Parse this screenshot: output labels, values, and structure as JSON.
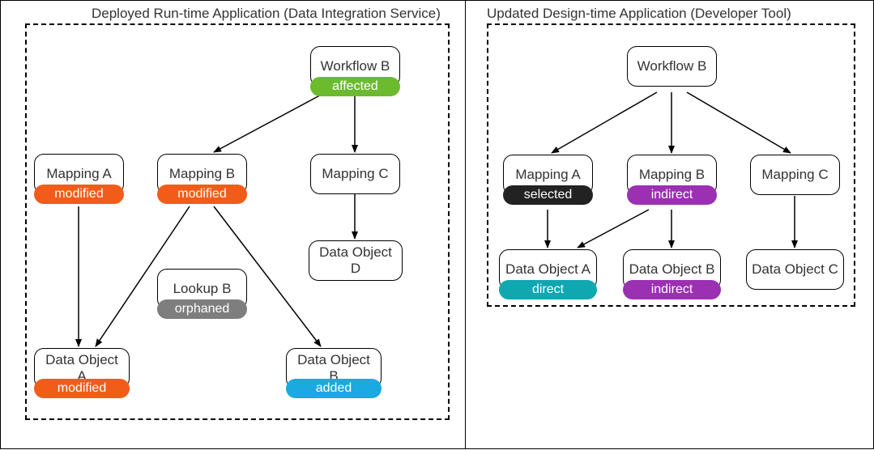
{
  "left_panel": {
    "title": "Deployed Run-time Application (Data Integration Service)",
    "nodes": {
      "workflow_b": {
        "label": "Workflow B",
        "badge": "affected"
      },
      "mapping_a": {
        "label": "Mapping A",
        "badge": "modified"
      },
      "mapping_b": {
        "label": "Mapping B",
        "badge": "modified"
      },
      "mapping_c": {
        "label": "Mapping C",
        "badge": null
      },
      "lookup_b": {
        "label": "Lookup B",
        "badge": "orphaned"
      },
      "data_object_a": {
        "label": "Data Object A",
        "badge": "modified"
      },
      "data_object_b": {
        "label": "Data Object B",
        "badge": "added"
      },
      "data_object_d": {
        "label": "Data Object D",
        "badge": null
      }
    },
    "edges": [
      {
        "from": "workflow_b",
        "to": "mapping_b"
      },
      {
        "from": "workflow_b",
        "to": "mapping_c"
      },
      {
        "from": "mapping_a",
        "to": "data_object_a"
      },
      {
        "from": "mapping_b",
        "to": "data_object_a"
      },
      {
        "from": "mapping_b",
        "to": "data_object_b"
      },
      {
        "from": "mapping_c",
        "to": "data_object_d"
      }
    ]
  },
  "right_panel": {
    "title": "Updated Design-time Application (Developer Tool)",
    "nodes": {
      "workflow_b": {
        "label": "Workflow B",
        "badge": null
      },
      "mapping_a": {
        "label": "Mapping A",
        "badge": "selected"
      },
      "mapping_b": {
        "label": "Mapping B",
        "badge": "indirect"
      },
      "mapping_c": {
        "label": "Mapping C",
        "badge": null
      },
      "data_object_a": {
        "label": "Data Object A",
        "badge": "direct"
      },
      "data_object_b": {
        "label": "Data Object B",
        "badge": "indirect"
      },
      "data_object_c": {
        "label": "Data Object C",
        "badge": null
      }
    },
    "edges": [
      {
        "from": "workflow_b",
        "to": "mapping_a"
      },
      {
        "from": "workflow_b",
        "to": "mapping_b"
      },
      {
        "from": "workflow_b",
        "to": "mapping_c"
      },
      {
        "from": "mapping_a",
        "to": "data_object_a"
      },
      {
        "from": "mapping_b",
        "to": "data_object_a"
      },
      {
        "from": "mapping_b",
        "to": "data_object_b"
      },
      {
        "from": "mapping_c",
        "to": "data_object_c"
      }
    ]
  },
  "badge_colors": {
    "affected": "#6cbb2f",
    "modified": "#f25c19",
    "orphaned": "#7e7e7e",
    "added": "#1aa9e0",
    "selected": "#222222",
    "indirect": "#9b30b3",
    "direct": "#0fa7b0"
  }
}
